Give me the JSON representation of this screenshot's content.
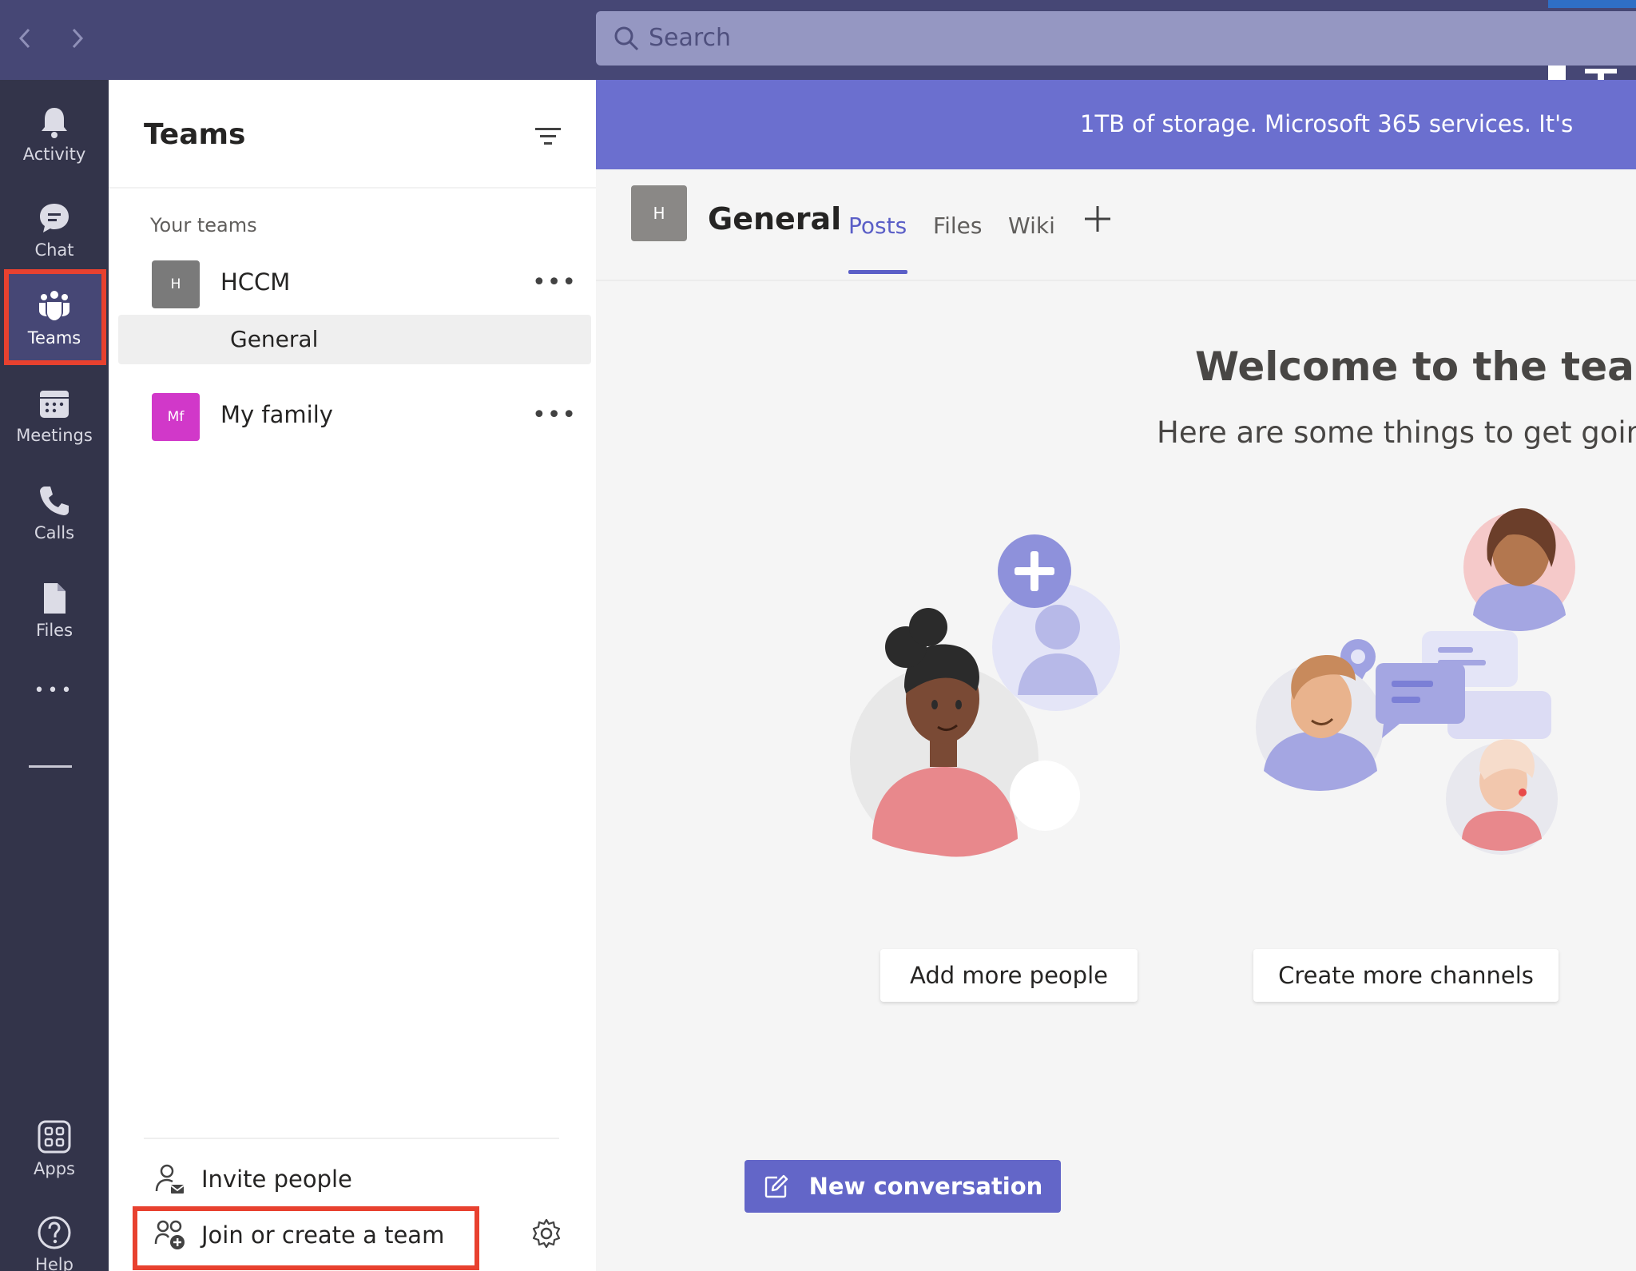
{
  "search": {
    "placeholder": "Search"
  },
  "rail": {
    "items": [
      {
        "label": "Activity",
        "icon": "bell-icon"
      },
      {
        "label": "Chat",
        "icon": "chat-icon"
      },
      {
        "label": "Teams",
        "icon": "teams-icon",
        "active": true
      },
      {
        "label": "Meetings",
        "icon": "calendar-icon"
      },
      {
        "label": "Calls",
        "icon": "phone-icon"
      },
      {
        "label": "Files",
        "icon": "file-icon"
      }
    ],
    "more": "•••",
    "apps": "Apps",
    "help": "Help"
  },
  "panel": {
    "title": "Teams",
    "section": "Your teams",
    "teams": [
      {
        "initials": "H",
        "name": "HCCM",
        "color": "#7a7a7a"
      },
      {
        "initials": "Mf",
        "name": "My family",
        "color": "#d138c9"
      }
    ],
    "channel": "General",
    "more": "•••",
    "invite": "Invite people",
    "join": "Join or create a team"
  },
  "main": {
    "banner": "1TB of storage. Microsoft 365 services. It's",
    "channel_initial": "H",
    "channel_title": "General",
    "tabs": [
      "Posts",
      "Files",
      "Wiki"
    ],
    "welcome_title": "Welcome to the team!",
    "welcome_sub": "Here are some things to get going.",
    "add_people": "Add more people",
    "create_channels": "Create more channels",
    "new_conversation": "New conversation"
  },
  "colors": {
    "topbar": "#464775",
    "rail": "#33344a",
    "accent": "#5b5fc7",
    "banner": "#6b6fcf",
    "highlight_box": "#e8412f"
  }
}
